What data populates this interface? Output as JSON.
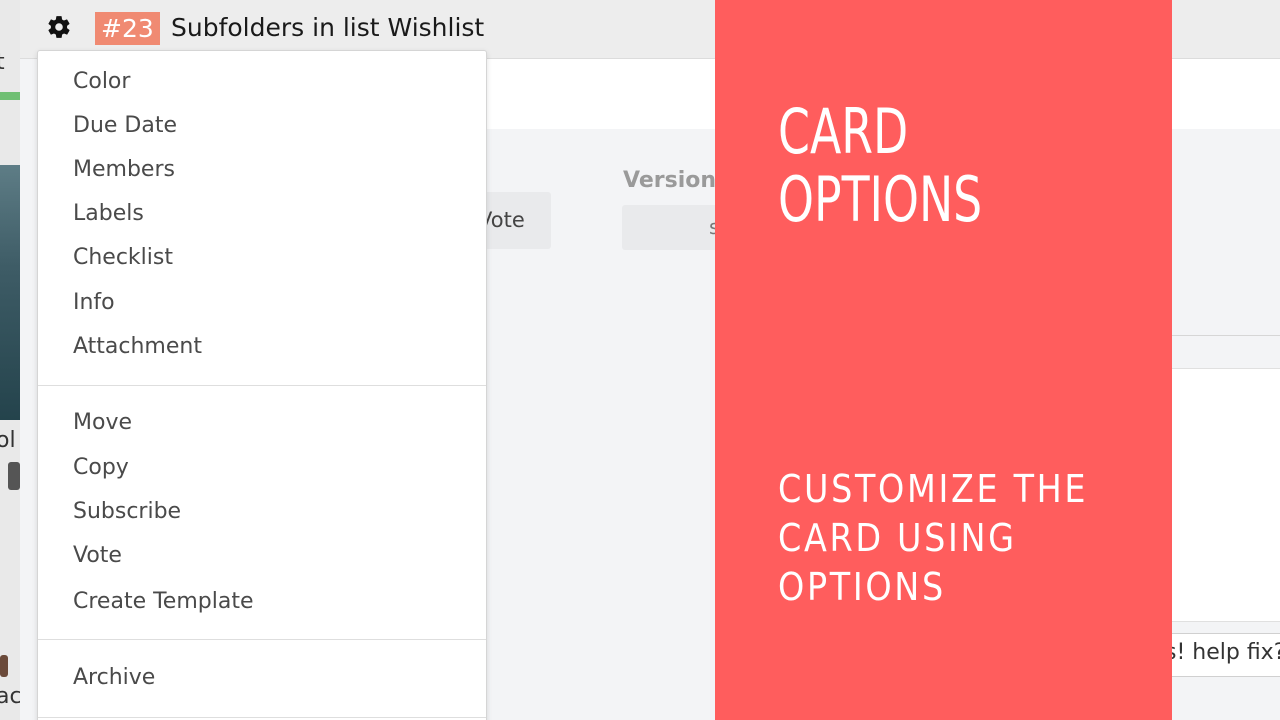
{
  "card": {
    "number": "#23",
    "title": "Subfolders in list Wishlist"
  },
  "menu": {
    "group1": [
      "Color",
      "Due Date",
      "Members",
      "Labels",
      "Checklist",
      "Info",
      "Attachment"
    ],
    "group2": [
      "Move",
      "Copy",
      "Subscribe",
      "Vote",
      "Create Template"
    ],
    "group3": [
      "Archive"
    ]
  },
  "background": {
    "vote_label": "Vote",
    "version_label": "Version",
    "version_value": "s",
    "help_text": "s! help fix?",
    "left_fragments": [
      "t",
      "ol",
      "ac"
    ]
  },
  "overlay": {
    "title_lines": [
      "CARD",
      "OPTIONS"
    ],
    "subtitle_lines": [
      "CUSTOMIZE THE",
      "CARD USING",
      "OPTIONS"
    ],
    "color": "#ff5d5d"
  },
  "colors": {
    "card_number_bg": "#f08a72",
    "header_bg": "#ededed"
  },
  "icons": {
    "settings": "gear-icon"
  }
}
